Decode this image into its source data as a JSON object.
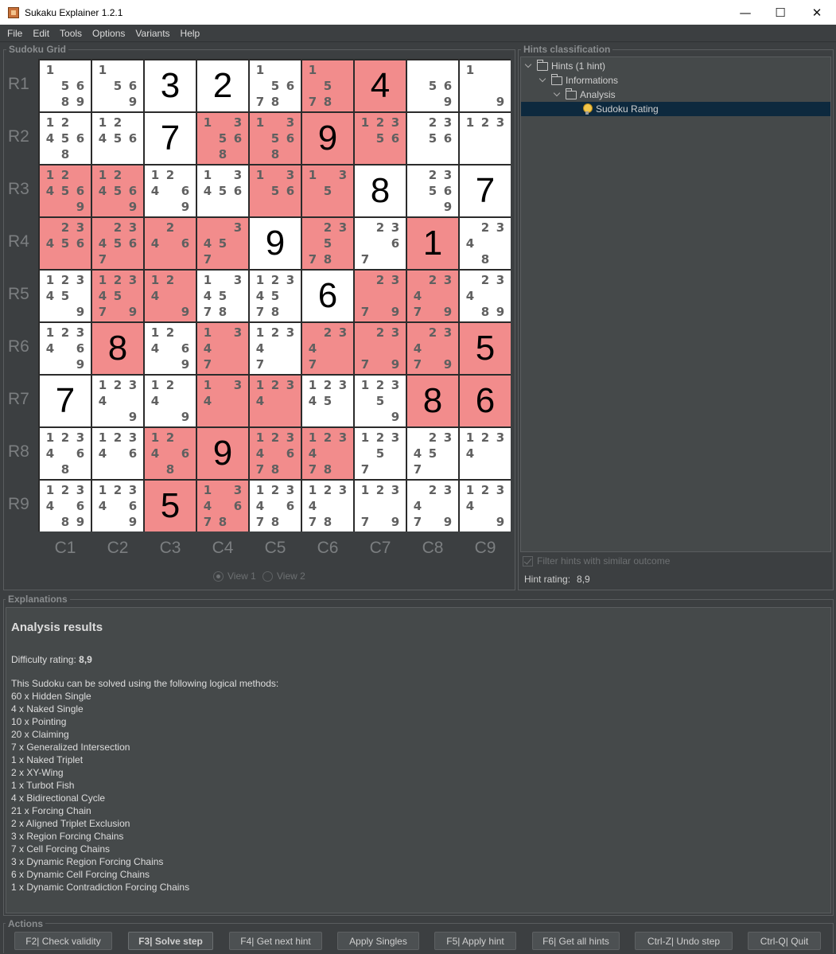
{
  "window": {
    "title": "Sukaku Explainer 1.2.1",
    "minimize": "—",
    "maximize": "☐",
    "close": "✕"
  },
  "menu": [
    "File",
    "Edit",
    "Tools",
    "Options",
    "Variants",
    "Help"
  ],
  "grid_panel": {
    "title": "Sudoku Grid",
    "view1": "View 1",
    "view2": "View 2"
  },
  "rows": [
    "R1",
    "R2",
    "R3",
    "R4",
    "R5",
    "R6",
    "R7",
    "R8",
    "R9"
  ],
  "cols": [
    "C1",
    "C2",
    "C3",
    "C4",
    "C5",
    "C6",
    "C7",
    "C8",
    "C9"
  ],
  "cells": [
    [
      {
        "c": "1 5 6 8 9"
      },
      {
        "c": "1 5 6 9"
      },
      {
        "v": "3"
      },
      {
        "v": "2"
      },
      {
        "c": "1 5 6 7 8"
      },
      {
        "c": "1 5 7 8",
        "h": 1
      },
      {
        "v": "4",
        "h": 1
      },
      {
        "c": "5 6 9"
      },
      {
        "c": "1 9"
      }
    ],
    [
      {
        "c": "1 2 4 5 6 8"
      },
      {
        "c": "1 2 4 5 6"
      },
      {
        "v": "7"
      },
      {
        "c": "1 3 5 6 8",
        "h": 1
      },
      {
        "c": "1 3 5 6 8",
        "h": 1
      },
      {
        "v": "9",
        "h": 1
      },
      {
        "c": "1 2 3 5 6",
        "h": 1
      },
      {
        "c": "2 3 5 6"
      },
      {
        "c": "1 2 3"
      }
    ],
    [
      {
        "c": "1 2 4 5 6 9",
        "h": 1
      },
      {
        "c": "1 2 4 5 6 9",
        "h": 1
      },
      {
        "c": "1 2 4 6 9"
      },
      {
        "c": "1 3 4 5 6"
      },
      {
        "c": "1 3 5 6",
        "h": 1
      },
      {
        "c": "1 3 5",
        "h": 1
      },
      {
        "v": "8"
      },
      {
        "c": "2 3 5 6 9"
      },
      {
        "v": "7"
      }
    ],
    [
      {
        "c": "2 3 4 5 6",
        "h": 1
      },
      {
        "c": "2 3 4 5 6 7",
        "h": 1
      },
      {
        "c": "2 4 6",
        "h": 1
      },
      {
        "c": "3 4 5 7",
        "h": 1
      },
      {
        "v": "9"
      },
      {
        "c": "2 3 5 7 8",
        "h": 1
      },
      {
        "c": "2 3 6 7"
      },
      {
        "v": "1",
        "h": 1
      },
      {
        "c": "2 3 4 8"
      }
    ],
    [
      {
        "c": "1 2 3 4 5 9"
      },
      {
        "c": "1 2 3 4 5 7 9",
        "h": 1
      },
      {
        "c": "1 2 4 9",
        "h": 1
      },
      {
        "c": "1 3 4 5 7 8"
      },
      {
        "c": "1 2 3 4 5 7 8"
      },
      {
        "v": "6"
      },
      {
        "c": "2 3 7 9",
        "h": 1
      },
      {
        "c": "2 3 4 7 9",
        "h": 1
      },
      {
        "c": "2 3 4 8 9"
      }
    ],
    [
      {
        "c": "1 2 3 4 6 9"
      },
      {
        "v": "8",
        "h": 1
      },
      {
        "c": "1 2 4 6 9"
      },
      {
        "c": "1 3 4 7",
        "h": 1
      },
      {
        "c": "1 2 3 4 7"
      },
      {
        "c": "2 3 4 7",
        "h": 1
      },
      {
        "c": "2 3 7 9",
        "h": 1
      },
      {
        "c": "2 3 4 7 9",
        "h": 1
      },
      {
        "v": "5",
        "h": 1
      }
    ],
    [
      {
        "v": "7"
      },
      {
        "c": "1 2 3 4 9"
      },
      {
        "c": "1 2 4 9"
      },
      {
        "c": "1 3 4",
        "h": 1
      },
      {
        "c": "1 2 3 4",
        "h": 1
      },
      {
        "c": "1 2 3 4 5"
      },
      {
        "c": "1 2 3 5 9"
      },
      {
        "v": "8",
        "h": 1
      },
      {
        "v": "6",
        "h": 1
      }
    ],
    [
      {
        "c": "1 2 3 4 6 8"
      },
      {
        "c": "1 2 3 4 6"
      },
      {
        "c": "1 2 4 6 8",
        "h": 1
      },
      {
        "v": "9",
        "h": 1
      },
      {
        "c": "1 2 3 4 6 7 8",
        "h": 1
      },
      {
        "c": "1 2 3 4 7 8",
        "h": 1
      },
      {
        "c": "1 2 3 5 7"
      },
      {
        "c": "2 3 4 5 7"
      },
      {
        "c": "1 2 3 4"
      }
    ],
    [
      {
        "c": "1 2 3 4 6 8 9"
      },
      {
        "c": "1 2 3 4 6 9"
      },
      {
        "v": "5",
        "h": 1
      },
      {
        "c": "1 3 4 6 7 8",
        "h": 1
      },
      {
        "c": "1 2 3 4 6 7 8"
      },
      {
        "c": "1 2 3 4 7 8"
      },
      {
        "c": "1 2 3 7 9"
      },
      {
        "c": "2 3 4 7 9"
      },
      {
        "c": "1 2 3 4 9"
      }
    ]
  ],
  "hints_panel": {
    "title": "Hints classification",
    "tree": [
      "Hints (1 hint)",
      "Informations",
      "Analysis",
      "Sudoku Rating"
    ],
    "filter_label": "Filter hints with similar outcome",
    "rating_label": "Hint rating:",
    "rating_value": "8,9"
  },
  "explanations": {
    "title": "Explanations",
    "heading": "Analysis results",
    "difficulty_label": "Difficulty rating:",
    "difficulty_value": "8,9",
    "intro": "This Sudoku can be solved using the following logical methods:",
    "methods": [
      "60 x Hidden Single",
      "4 x Naked Single",
      "10 x Pointing",
      "20 x Claiming",
      "7 x Generalized Intersection",
      "1 x Naked Triplet",
      "2 x XY-Wing",
      "1 x Turbot Fish",
      "4 x Bidirectional Cycle",
      "21 x Forcing Chain",
      "2 x Aligned Triplet Exclusion",
      "3 x Region Forcing Chains",
      "7 x Cell Forcing Chains",
      "3 x Dynamic Region Forcing Chains",
      "6 x Dynamic Cell Forcing Chains",
      "1 x Dynamic Contradiction Forcing Chains"
    ]
  },
  "actions": {
    "title": "Actions",
    "buttons": [
      "F2| Check validity",
      "F3| Solve step",
      "F4| Get next hint",
      "Apply Singles",
      "F5| Apply hint",
      "F6| Get all hints",
      "Ctrl-Z| Undo step",
      "Ctrl-Q| Quit"
    ]
  },
  "colors": {
    "highlight": "#f28c8c",
    "background": "#3c3f41",
    "selection": "#0d293e"
  }
}
